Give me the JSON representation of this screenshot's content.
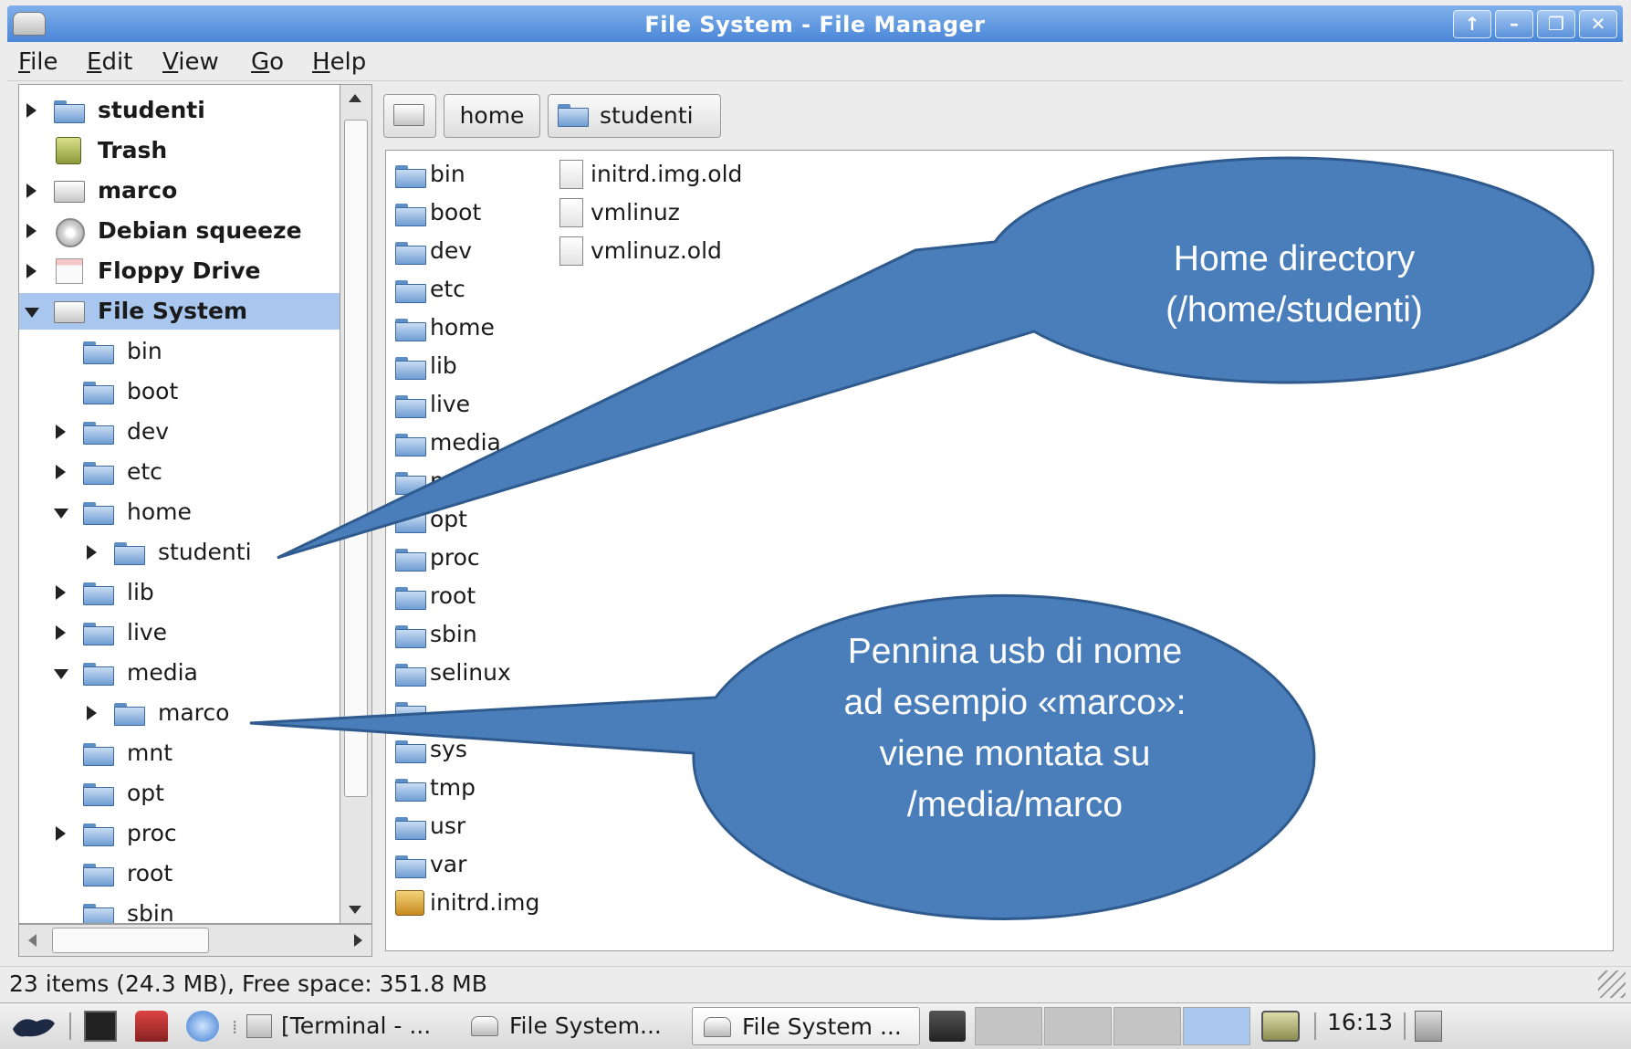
{
  "window": {
    "title": "File System - File Manager"
  },
  "menubar": [
    "File",
    "Edit",
    "View",
    "Go",
    "Help"
  ],
  "sidebar": {
    "places": [
      {
        "label": "studenti",
        "icon": "home-folder-icon",
        "expander": "closed"
      },
      {
        "label": "Trash",
        "icon": "trash-icon",
        "expander": "none"
      },
      {
        "label": "marco",
        "icon": "drive-icon",
        "expander": "closed"
      },
      {
        "label": "Debian squeeze",
        "icon": "cdrom-icon",
        "expander": "closed"
      },
      {
        "label": "Floppy Drive",
        "icon": "floppy-icon",
        "expander": "closed"
      },
      {
        "label": "File System",
        "icon": "drive-icon",
        "expander": "open",
        "selected": true
      }
    ],
    "tree": [
      {
        "label": "bin",
        "level": 1,
        "expander": "none"
      },
      {
        "label": "boot",
        "level": 1,
        "expander": "none"
      },
      {
        "label": "dev",
        "level": 1,
        "expander": "closed"
      },
      {
        "label": "etc",
        "level": 1,
        "expander": "closed"
      },
      {
        "label": "home",
        "level": 1,
        "expander": "open"
      },
      {
        "label": "studenti",
        "level": 2,
        "expander": "closed"
      },
      {
        "label": "lib",
        "level": 1,
        "expander": "closed"
      },
      {
        "label": "live",
        "level": 1,
        "expander": "closed"
      },
      {
        "label": "media",
        "level": 1,
        "expander": "open"
      },
      {
        "label": "marco",
        "level": 2,
        "expander": "closed"
      },
      {
        "label": "mnt",
        "level": 1,
        "expander": "none"
      },
      {
        "label": "opt",
        "level": 1,
        "expander": "none"
      },
      {
        "label": "proc",
        "level": 1,
        "expander": "closed"
      },
      {
        "label": "root",
        "level": 1,
        "expander": "none"
      },
      {
        "label": "sbin",
        "level": 1,
        "expander": "none"
      }
    ]
  },
  "pathbar": {
    "items": [
      "home",
      "studenti"
    ]
  },
  "files": {
    "column1": [
      {
        "name": "bin",
        "type": "folder"
      },
      {
        "name": "boot",
        "type": "folder"
      },
      {
        "name": "dev",
        "type": "folder"
      },
      {
        "name": "etc",
        "type": "folder"
      },
      {
        "name": "home",
        "type": "folder"
      },
      {
        "name": "lib",
        "type": "folder"
      },
      {
        "name": "live",
        "type": "folder"
      },
      {
        "name": "media",
        "type": "folder"
      },
      {
        "name": "mnt",
        "type": "folder"
      },
      {
        "name": "opt",
        "type": "folder"
      },
      {
        "name": "proc",
        "type": "folder"
      },
      {
        "name": "root",
        "type": "folder"
      },
      {
        "name": "sbin",
        "type": "folder"
      },
      {
        "name": "selinux",
        "type": "folder"
      },
      {
        "name": "",
        "type": "folder"
      },
      {
        "name": "sys",
        "type": "folder"
      },
      {
        "name": "tmp",
        "type": "folder"
      },
      {
        "name": "usr",
        "type": "folder"
      },
      {
        "name": "var",
        "type": "folder"
      },
      {
        "name": "initrd.img",
        "type": "image"
      }
    ],
    "column2": [
      {
        "name": "initrd.img.old",
        "type": "file"
      },
      {
        "name": "vmlinuz",
        "type": "file"
      },
      {
        "name": "vmlinuz.old",
        "type": "file"
      }
    ]
  },
  "status": {
    "text": "23 items (24.3 MB), Free space: 351.8 MB"
  },
  "taskbar": {
    "tasks": [
      "[Terminal - ...",
      "File System...",
      "File System ..."
    ],
    "clock": "16:13"
  },
  "callouts": {
    "home": [
      "Home directory",
      "(/home/studenti)"
    ],
    "usb": [
      "Pennina usb di nome",
      "ad esempio «marco»:",
      "viene montata su",
      "/media/marco"
    ]
  },
  "colors": {
    "callout_fill": "#4a7ebb",
    "callout_stroke": "#2f5a8e",
    "titlebar": "#5a92dc",
    "selection": "#a9c7ee"
  }
}
